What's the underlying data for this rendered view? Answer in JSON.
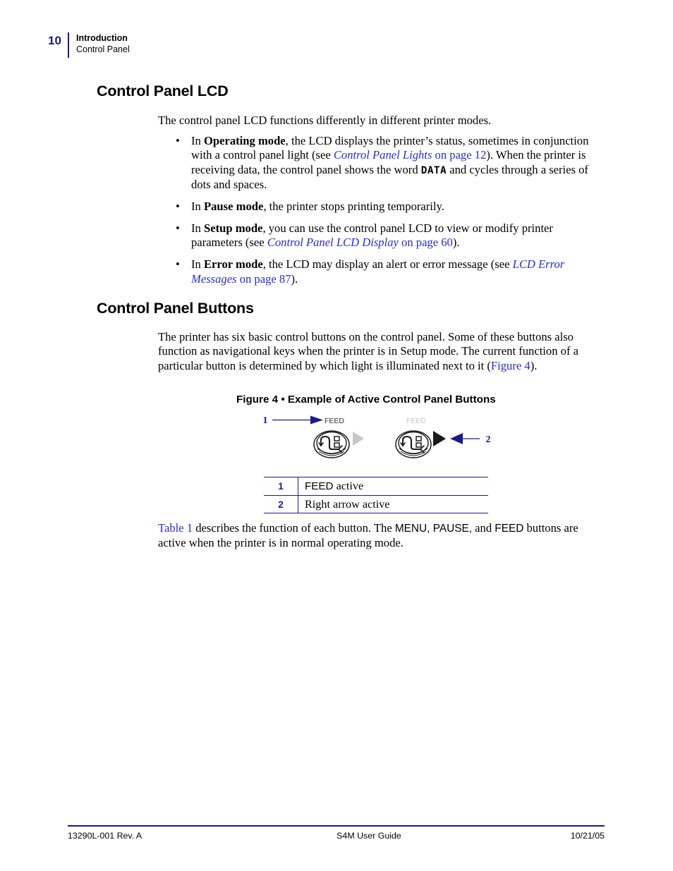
{
  "header": {
    "page_number": "10",
    "chapter": "Introduction",
    "section": "Control Panel",
    "rule_color": "#1a1a8c"
  },
  "sections": [
    {
      "title": "Control Panel LCD",
      "intro": "The control panel LCD functions differently in different printer modes.",
      "bullets": [
        {
          "mode": "Operating mode",
          "lead": "In ",
          "text_1": ", the LCD displays the printer’s status, sometimes in conjunction with a control panel light (see ",
          "xref_title": "Control Panel Lights",
          "xref_page": " on page 12",
          "text_2": "). When the printer is receiving data, the control panel shows the word ",
          "lcd_word": "DATA",
          "text_3": " and cycles through a series of dots and spaces."
        },
        {
          "mode": "Pause mode",
          "lead": "In ",
          "text_1": ", the printer stops printing temporarily."
        },
        {
          "mode": "Setup mode",
          "lead": "In ",
          "text_1": ", you can use the control panel LCD to view or modify printer parameters (see ",
          "xref_title": "Control Panel LCD Display",
          "xref_page": " on page 60",
          "text_2": ")."
        },
        {
          "mode": "Error mode",
          "lead": "In ",
          "text_1": ", the LCD may display an alert or error message (see ",
          "xref_title": "LCD Error Messages",
          "xref_page": " on page 87",
          "text_2": ")."
        }
      ],
      "bullet_glyph": "•"
    },
    {
      "title": "Control Panel Buttons",
      "paragraph_1": "The printer has six basic control buttons on the control panel. Some of these buttons also function as navigational keys when the printer is in Setup mode. The current function of a particular button is determined by which light is illuminated next to it (",
      "paragraph_1_xref": "Figure 4",
      "paragraph_1_end": ")."
    }
  ],
  "figure": {
    "caption_label": "Figure 4",
    "caption_separator": "•",
    "caption_text": "Example of Active Control Panel Buttons",
    "callout_1": "1",
    "callout_2": "2",
    "feed_label_active": "FEED",
    "feed_label_inactive": "FEED",
    "colors": {
      "callout": "#1a1a8c",
      "arrow": "#1a1a8c",
      "active_triangle": "#1a1a1a",
      "inactive_triangle": "#c6c6c6",
      "inactive_label": "#c6c6c6",
      "active_label": "#333333",
      "button_outline": "#1a1a1a"
    }
  },
  "legend": {
    "rows": [
      {
        "number": "1",
        "label_sans": "FEED",
        "label_serif": " active"
      },
      {
        "number": "2",
        "label_sans": "",
        "label_serif": "Right arrow active"
      }
    ]
  },
  "closing": {
    "xref": "Table 1",
    "text_1": " describes the function of each button. The ",
    "buttons": "MENU, PAUSE,",
    "text_2": " and ",
    "buttons_2": "FEED",
    "text_3": " buttons are active when the printer is in normal operating mode."
  },
  "footer": {
    "left": "13290L-001 Rev. A",
    "center": "S4M User Guide",
    "right": "10/21/05",
    "rule_color": "#1a1a8c"
  }
}
